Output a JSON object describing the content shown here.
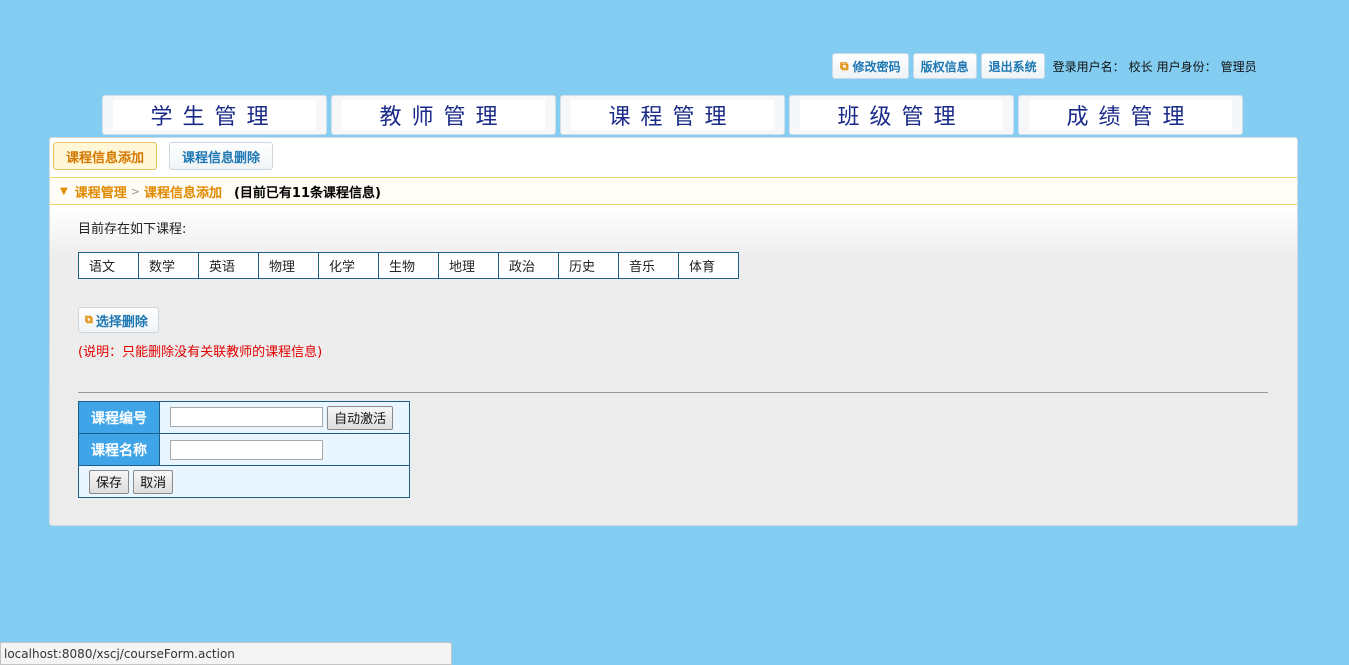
{
  "toolbar": {
    "change_password": "修改密码",
    "copyright": "版权信息",
    "logout": "退出系统"
  },
  "user": {
    "login_label": "登录用户名：",
    "login_name": "校长",
    "role_label": "用户身份：",
    "role": "管理员"
  },
  "nav": {
    "items": [
      {
        "label": "学生管理"
      },
      {
        "label": "教师管理"
      },
      {
        "label": "课程管理"
      },
      {
        "label": "班级管理"
      },
      {
        "label": "成绩管理"
      }
    ]
  },
  "subtabs": {
    "add": "课程信息添加",
    "delete": "课程信息删除"
  },
  "breadcrumb": {
    "level1": "课程管理",
    "separator": ">",
    "level2": "课程信息添加",
    "count_text": "(目前已有11条课程信息)"
  },
  "existing": {
    "label": "目前存在如下课程:",
    "courses": [
      "语文",
      "数学",
      "英语",
      "物理",
      "化学",
      "生物",
      "地理",
      "政治",
      "历史",
      "音乐",
      "体育"
    ]
  },
  "delete_section": {
    "button": "选择删除",
    "note": "(说明：只能删除没有关联教师的课程信息)"
  },
  "form": {
    "course_id_label": "课程编号",
    "course_id_value": "",
    "auto_button": "自动激活",
    "course_name_label": "课程名称",
    "course_name_value": "",
    "save_button": "保存",
    "cancel_button": "取消"
  },
  "status": {
    "url": "localhost:8080/xscj/courseForm.action"
  },
  "colors": {
    "background": "#82cdf1",
    "accent_orange": "#e08a00",
    "link_blue": "#1e78b4",
    "label_blue": "#3fa4e8",
    "note_red": "#e20000"
  }
}
